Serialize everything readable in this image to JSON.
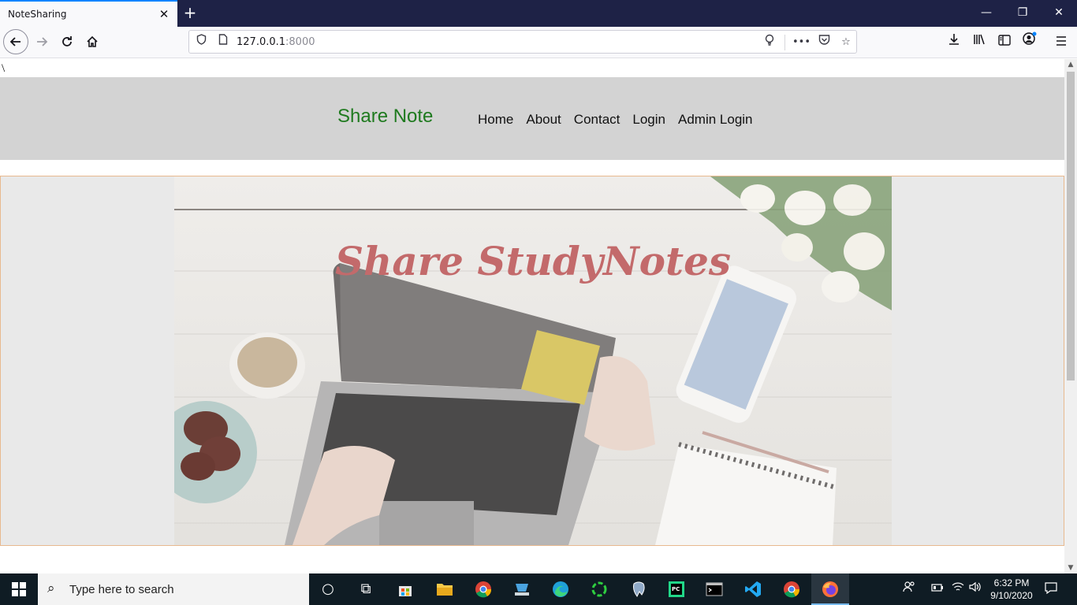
{
  "browser": {
    "tab_title": "NoteSharing",
    "tab_close": "✕",
    "new_tab": "+",
    "window": {
      "minimize": "—",
      "restore": "❐",
      "close": "✕"
    },
    "url_host": "127.0.0.1",
    "url_port": ":8000",
    "icons": [
      "shield-icon",
      "page-icon",
      "lightbulb-icon",
      "more-icon",
      "pocket-icon",
      "star-icon",
      "download-icon",
      "library-icon",
      "sidebar-icon",
      "account-icon",
      "menu-icon"
    ]
  },
  "page": {
    "stray_text": "\\",
    "brand": "Share Note",
    "menu": [
      "Home",
      "About",
      "Contact",
      "Login",
      "Admin Login"
    ],
    "hero_title": "Share StudyNotes",
    "colors": {
      "header_bg": "#d3d3d3",
      "brand": "#1f7a1f",
      "hero_title": "#c36a6b",
      "hero_border": "#e8b98f"
    }
  },
  "taskbar": {
    "search_placeholder": "Type here to search",
    "time": "6:32 PM",
    "date": "9/10/2020",
    "apps": [
      "cortana-icon",
      "task-view-icon",
      "store-icon",
      "file-explorer-icon",
      "chrome-icon",
      "network-drive-icon",
      "edge-icon",
      "sync-icon",
      "postgres-icon",
      "pycharm-icon",
      "terminal-icon",
      "vscode-icon",
      "chrome-icon",
      "firefox-icon"
    ]
  }
}
